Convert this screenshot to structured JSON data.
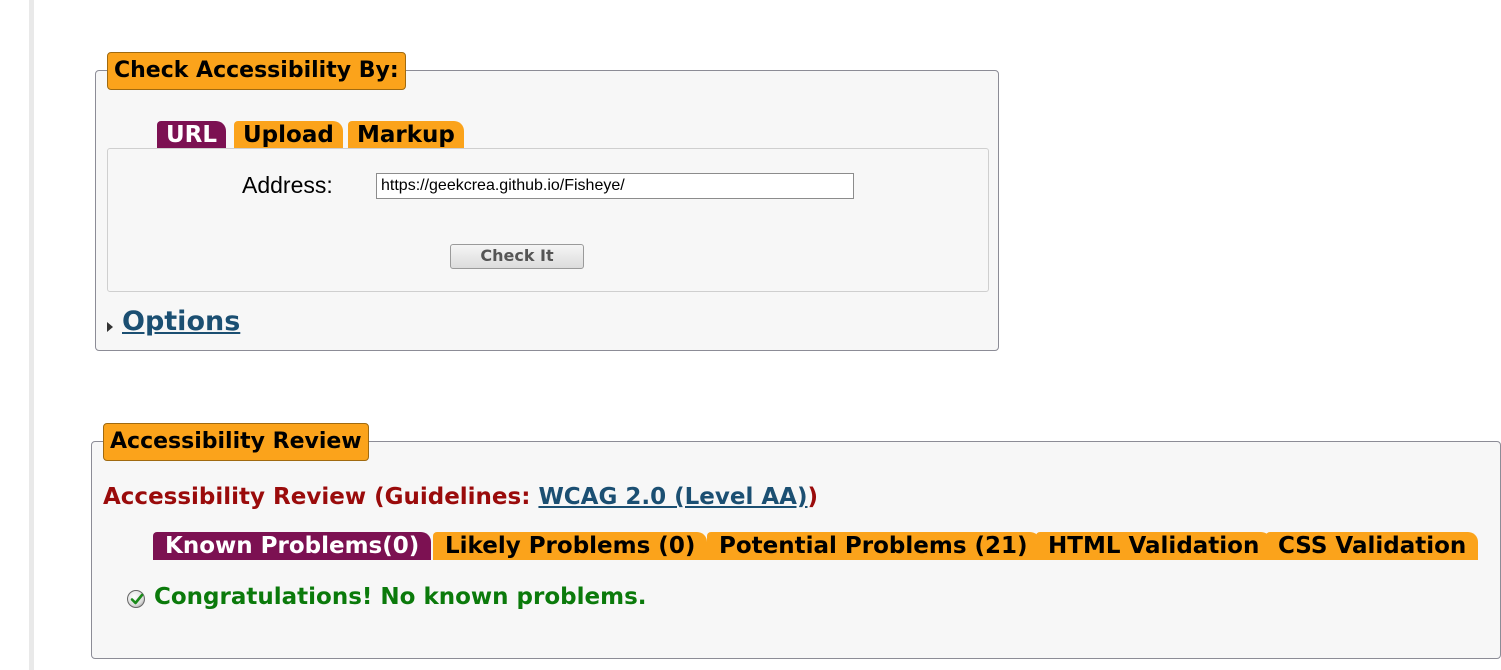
{
  "check_section": {
    "legend": "Check Accessibility By:",
    "tabs": [
      {
        "label": "URL",
        "active": true
      },
      {
        "label": "Upload",
        "active": false
      },
      {
        "label": "Markup",
        "active": false
      }
    ],
    "address_label": "Address:",
    "address_value": "https://geekcrea.github.io/Fisheye/",
    "check_button": "Check It",
    "options_link": "Options"
  },
  "review_section": {
    "legend": "Accessibility Review",
    "heading_prefix": "Accessibility Review (Guidelines: ",
    "heading_link": "WCAG 2.0 (Level AA)",
    "heading_suffix": ")",
    "tabs": [
      {
        "label": "Known Problems(0)",
        "active": true
      },
      {
        "label": "Likely Problems (0)",
        "active": false
      },
      {
        "label": "Potential Problems (21)",
        "active": false
      },
      {
        "label": "HTML Validation",
        "active": false
      },
      {
        "label": "CSS Validation",
        "active": false
      }
    ],
    "message": "Congratulations! No known problems.",
    "message_icon": "check-ok-icon"
  },
  "colors": {
    "tab_orange": "#fba31b",
    "tab_active": "#7c1152",
    "heading_red": "#9a0b0b",
    "link_blue": "#1b4f72",
    "success_green": "#0b7a0b"
  }
}
